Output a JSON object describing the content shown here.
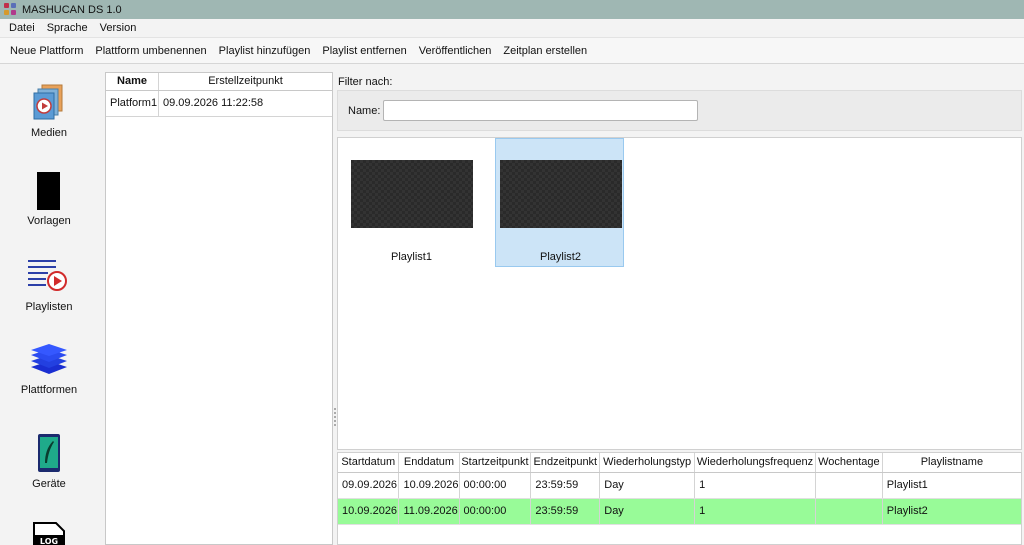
{
  "window": {
    "title": "MASHUCAN DS 1.0"
  },
  "menu": [
    "Datei",
    "Sprache",
    "Version"
  ],
  "toolbar": [
    "Neue Plattform",
    "Plattform umbenennen",
    "Playlist hinzufügen",
    "Playlist entfernen",
    "Veröffentlichen",
    "Zeitplan erstellen"
  ],
  "sidebar": {
    "medien": "Medien",
    "vorlagen": "Vorlagen",
    "playlisten": "Playlisten",
    "plattformen": "Plattformen",
    "geraete": "Geräte",
    "log_icon_text": "LOG"
  },
  "platforms": {
    "columns": [
      "Name",
      "Erstellzeitpunkt"
    ],
    "rows": [
      {
        "name": "Platform1",
        "created": "09.09.2026 11:22:58"
      }
    ]
  },
  "filter": {
    "title": "Filter nach:",
    "name_label": "Name:",
    "name_value": ""
  },
  "playlists": [
    {
      "name": "Playlist1",
      "selected": false
    },
    {
      "name": "Playlist2",
      "selected": true
    }
  ],
  "schedule": {
    "columns": [
      "Startdatum",
      "Enddatum",
      "Startzeitpunkt",
      "Endzeitpunkt",
      "Wiederholungstyp",
      "Wiederholungsfrequenz",
      "Wochentage",
      "Playlistname"
    ],
    "rows": [
      {
        "cells": [
          "09.09.2026",
          "10.09.2026",
          "00:00:00",
          "23:59:59",
          "Day",
          "1",
          "",
          "Playlist1"
        ],
        "highlighted": false
      },
      {
        "cells": [
          "10.09.2026",
          "11.09.2026",
          "00:00:00",
          "23:59:59",
          "Day",
          "1",
          "",
          "Playlist2"
        ],
        "highlighted": true
      }
    ]
  },
  "colors": {
    "titlebar": "#9fb7b3",
    "selection": "#cce4f7",
    "highlight_row": "#98fb98"
  }
}
